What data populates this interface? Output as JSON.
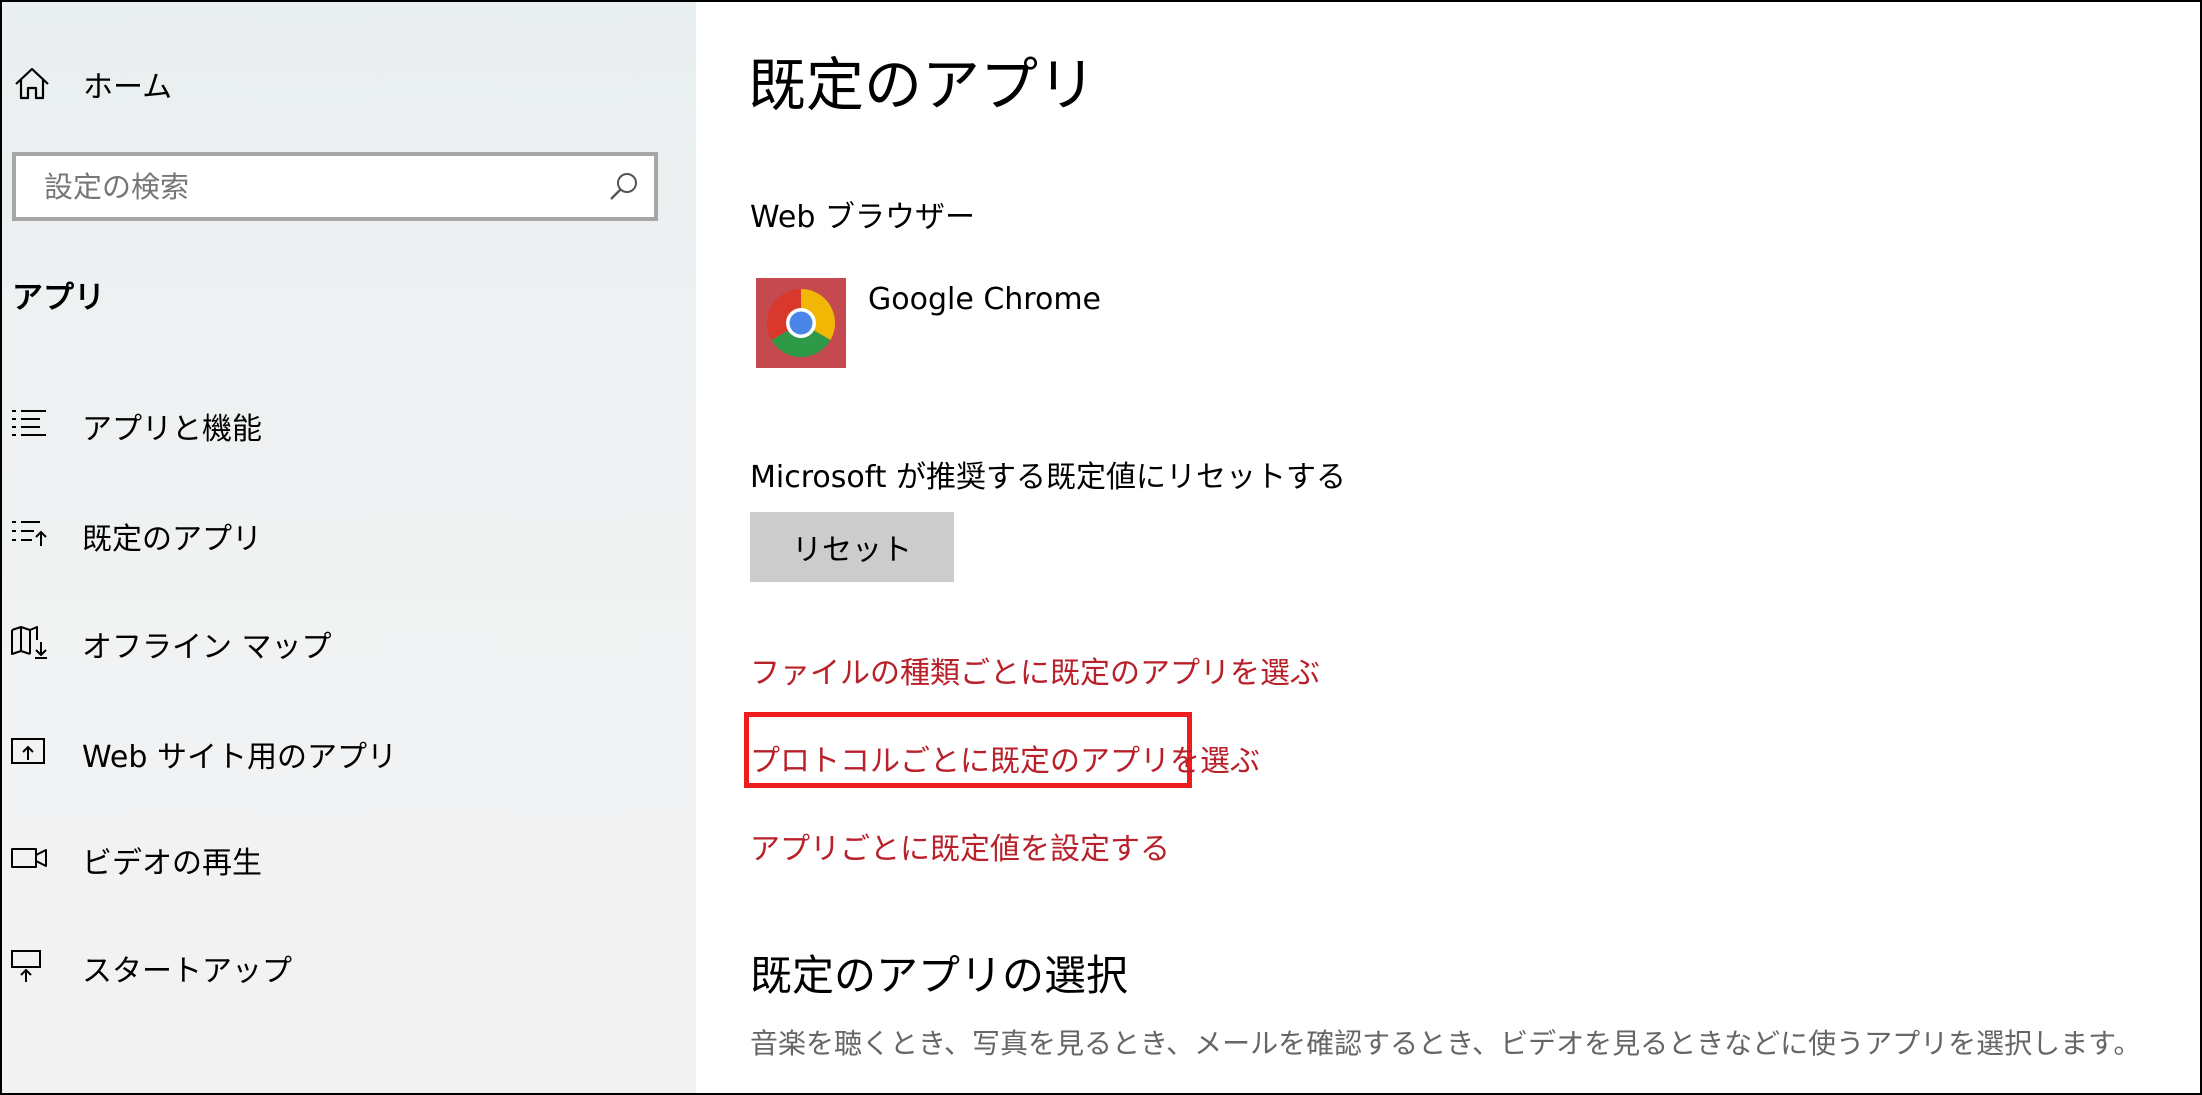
{
  "sidebar": {
    "home_label": "ホーム",
    "search_placeholder": "設定の検索",
    "section_title": "アプリ",
    "items": [
      {
        "label": "アプリと機能",
        "icon": "list-icon"
      },
      {
        "label": "既定のアプリ",
        "icon": "default-apps-icon"
      },
      {
        "label": "オフライン マップ",
        "icon": "map-download-icon"
      },
      {
        "label": "Web サイト用のアプリ",
        "icon": "open-website-icon"
      },
      {
        "label": "ビデオの再生",
        "icon": "video-icon"
      },
      {
        "label": "スタートアップ",
        "icon": "startup-icon"
      }
    ]
  },
  "main": {
    "title": "既定のアプリ",
    "web_browser": {
      "heading": "Web ブラウザー",
      "app_name": "Google Chrome",
      "icon": "chrome-icon",
      "tile_color": "#c44a4f"
    },
    "reset": {
      "heading": "Microsoft が推奨する既定値にリセットする",
      "button_label": "リセット"
    },
    "links": [
      "ファイルの種類ごとに既定のアプリを選ぶ",
      "プロトコルごとに既定のアプリを選ぶ",
      "アプリごとに既定値を設定する"
    ],
    "section2": {
      "title": "既定のアプリの選択",
      "description": "音楽を聴くとき、写真を見るとき、メールを確認するとき、ビデオを見るときなどに使うアプリを選択します。"
    }
  },
  "colors": {
    "link": "#b8202a",
    "highlight": "#ee1c1c",
    "button": "#cccccc"
  }
}
